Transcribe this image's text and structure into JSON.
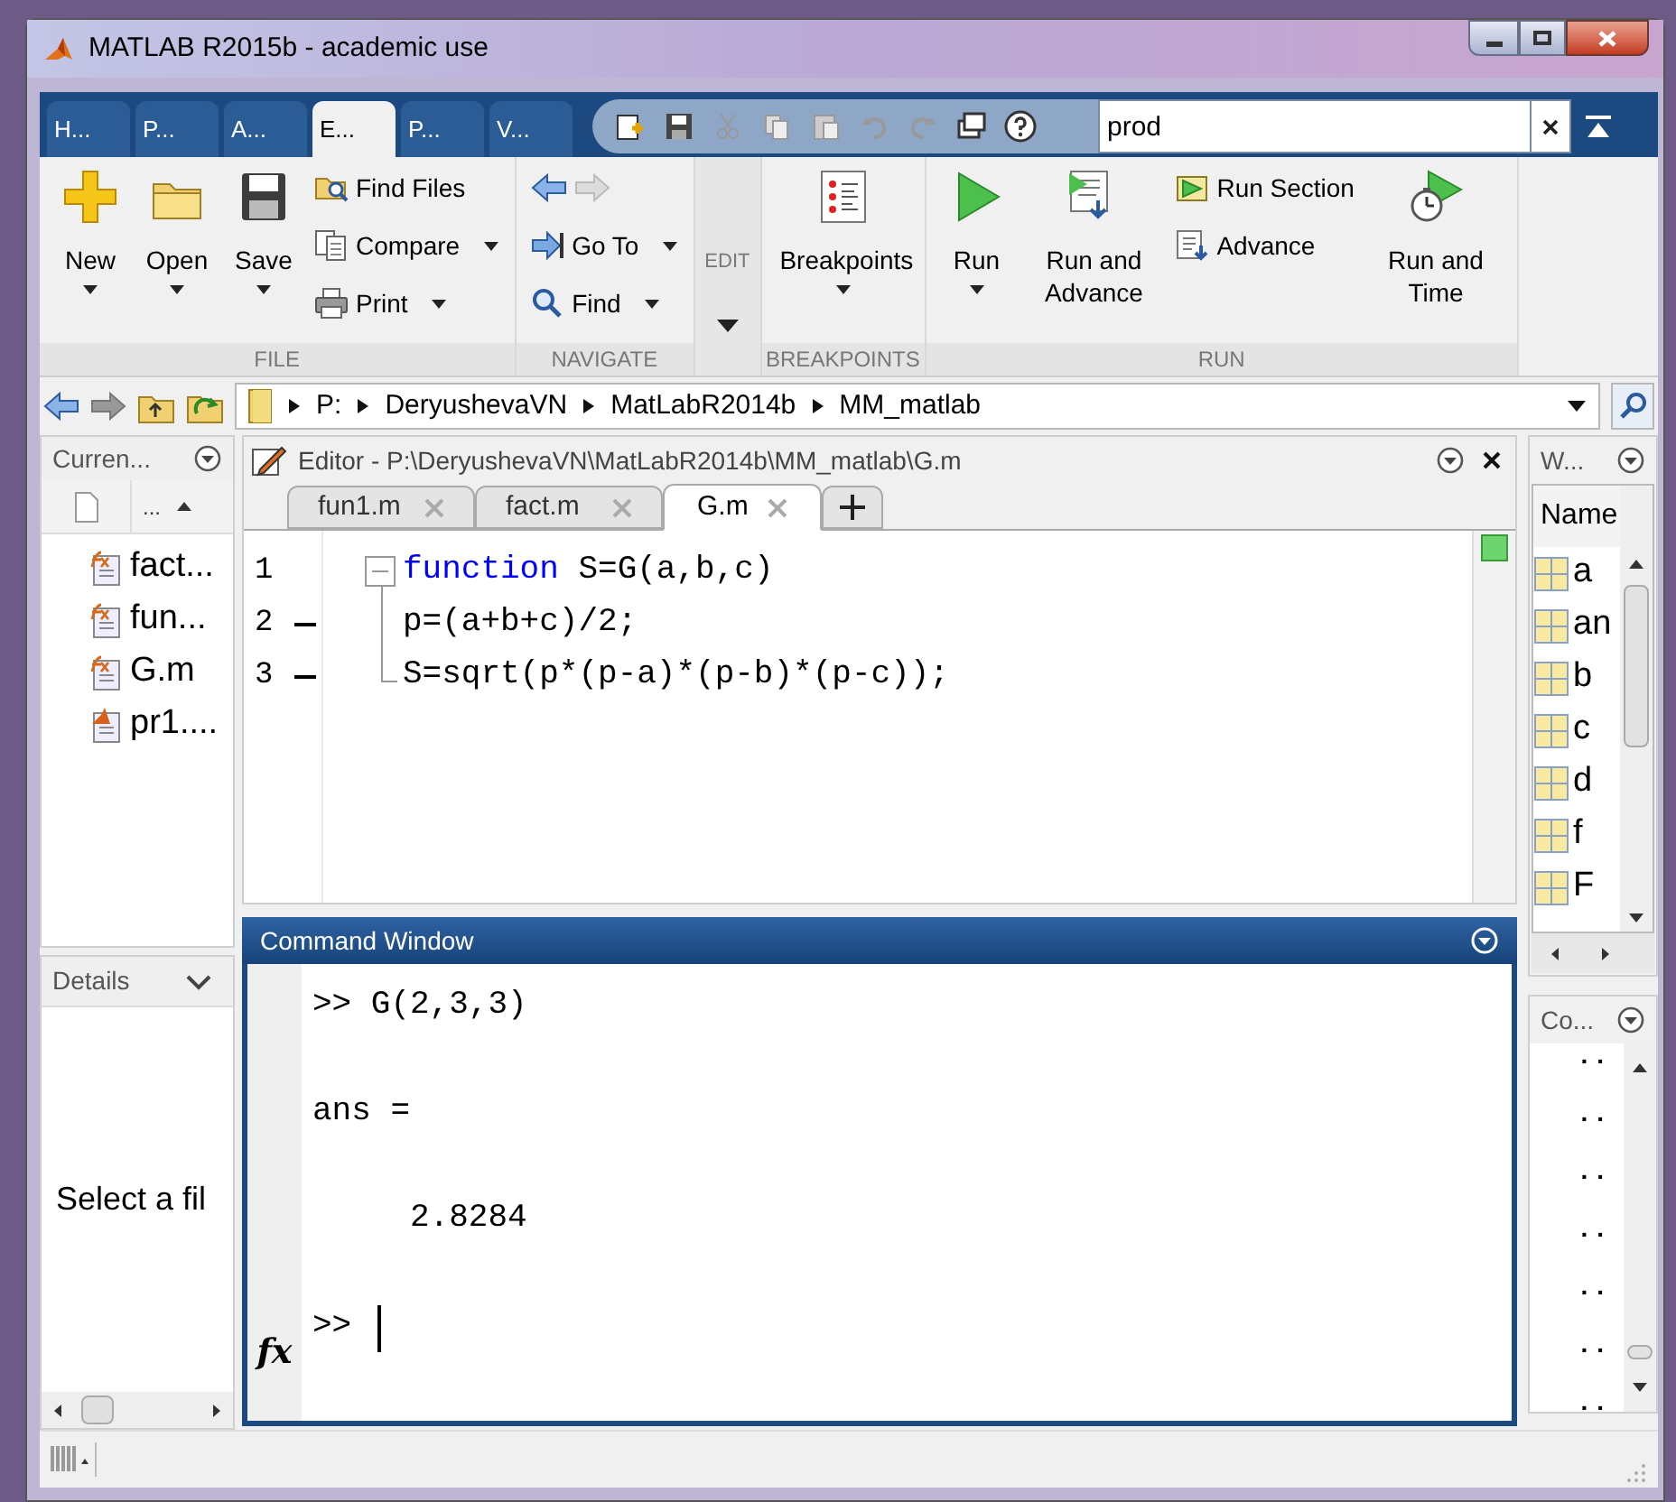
{
  "window": {
    "title": "MATLAB R2015b - academic use"
  },
  "toolstrip": {
    "tabs": [
      {
        "label": "H...",
        "selected": false
      },
      {
        "label": "P...",
        "selected": false
      },
      {
        "label": "A...",
        "selected": false
      },
      {
        "label": "E...",
        "selected": true
      },
      {
        "label": "P...",
        "selected": false
      },
      {
        "label": "V...",
        "selected": false
      }
    ],
    "search": {
      "value": "prod"
    }
  },
  "ribbon": {
    "sections": [
      {
        "title": "FILE",
        "kind": "normal",
        "buttons": [
          {
            "kind": "large",
            "label": "New",
            "dropdown": true
          },
          {
            "kind": "large",
            "label": "Open",
            "dropdown": true
          },
          {
            "kind": "large",
            "label": "Save",
            "dropdown": true
          },
          {
            "kind": "small",
            "label": "Find Files",
            "dropdown": false
          },
          {
            "kind": "small",
            "label": "Compare",
            "dropdown": true
          },
          {
            "kind": "small",
            "label": "Print",
            "dropdown": true
          }
        ]
      },
      {
        "title": "NAVIGATE",
        "kind": "normal",
        "buttons": [
          {
            "kind": "arrows"
          },
          {
            "kind": "small",
            "label": "Go To",
            "dropdown": true
          },
          {
            "kind": "small",
            "label": "Find",
            "dropdown": true
          }
        ]
      },
      {
        "title": "EDIT",
        "kind": "collapsed"
      },
      {
        "title": "BREAKPOINTS",
        "kind": "normal",
        "buttons": [
          {
            "kind": "large",
            "label": "Breakpoints",
            "dropdown": true
          }
        ]
      },
      {
        "title": "RUN",
        "kind": "normal",
        "buttons": [
          {
            "kind": "large",
            "label": "Run",
            "dropdown": true
          },
          {
            "kind": "large",
            "label": "Run and Advance",
            "dropdown": false
          },
          {
            "kind": "small",
            "label": "Run Section",
            "dropdown": false
          },
          {
            "kind": "small",
            "label": "Advance",
            "dropdown": false
          },
          {
            "kind": "large",
            "label": "Run and Time",
            "dropdown": false
          }
        ]
      }
    ]
  },
  "address_bar": {
    "path": [
      "P:",
      "DeryushevaVN",
      "MatLabR2014b",
      "MM_matlab"
    ]
  },
  "current_folder": {
    "title": "Curren...",
    "column": "...",
    "files": [
      {
        "name": "fact...",
        "kind": "function"
      },
      {
        "name": "fun...",
        "kind": "function"
      },
      {
        "name": "G.m",
        "kind": "function"
      },
      {
        "name": "pr1....",
        "kind": "script"
      }
    ]
  },
  "details": {
    "title": "Details",
    "message": "Select a fil"
  },
  "editor": {
    "title": "Editor - P:\\DeryushevaVN\\MatLabR2014b\\MM_matlab\\G.m",
    "tabs": [
      {
        "label": "fun1.m",
        "selected": false
      },
      {
        "label": "fact.m",
        "selected": false
      },
      {
        "label": "G.m",
        "selected": true
      }
    ],
    "lines": [
      {
        "number": "1",
        "executable": false,
        "foldable": true,
        "code": [
          {
            "kind": "keyword",
            "text": "function"
          },
          {
            "kind": "plain",
            "text": " S=G(a,b,c)"
          }
        ]
      },
      {
        "number": "2",
        "executable": true,
        "foldable": false,
        "code": [
          {
            "kind": "plain",
            "text": "p=(a+b+c)/2;"
          }
        ]
      },
      {
        "number": "3",
        "executable": true,
        "foldable": false,
        "code": [
          {
            "kind": "plain",
            "text": "S=sqrt(p*(p-a)*(p-b)*(p-c));"
          }
        ]
      }
    ]
  },
  "command_window": {
    "title": "Command Window",
    "lines": [
      {
        "kind": "command",
        "text": ">> G(2,3,3)"
      },
      {
        "kind": "output",
        "text": "ans ="
      },
      {
        "kind": "value",
        "text": "2.8284"
      }
    ],
    "fx": "fx",
    "prompt": ">>"
  },
  "workspace": {
    "title": "W...",
    "column": "Name",
    "variables": [
      "a",
      "an",
      "b",
      "c",
      "d",
      "f",
      "F"
    ]
  },
  "command_history": {
    "title": "Co...",
    "entries": [
      "..",
      "..",
      "..",
      "..",
      "..",
      "..",
      ".."
    ]
  }
}
